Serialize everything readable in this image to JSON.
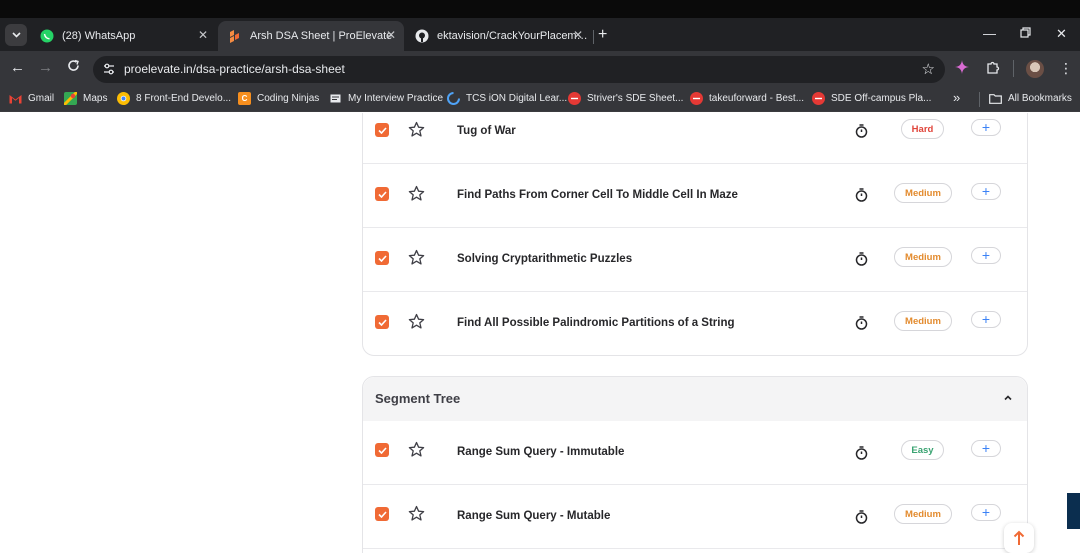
{
  "browser": {
    "tabs": [
      {
        "title": "(28) WhatsApp",
        "icon": "whatsapp-icon",
        "active": false
      },
      {
        "title": "Arsh DSA Sheet | ProElevate",
        "icon": "proelevate-icon",
        "active": true
      },
      {
        "title": "ektavision/CrackYourPlacement",
        "icon": "github-icon",
        "active": false
      }
    ],
    "url": {
      "host": "proelevate.in",
      "path": "/dsa-practice/arsh-dsa-sheet"
    },
    "bookmarks": [
      {
        "label": "Gmail",
        "icon": "gmail-icon"
      },
      {
        "label": "Maps",
        "icon": "maps-icon"
      },
      {
        "label": "8 Front-End Develo...",
        "icon": "chrome-icon"
      },
      {
        "label": "Coding Ninjas",
        "icon": "coding-ninjas-icon"
      },
      {
        "label": "My Interview Practice",
        "icon": "bookmark-icon"
      },
      {
        "label": "TCS iON Digital Lear...",
        "icon": "tcs-icon"
      },
      {
        "label": "Striver's SDE Sheet...",
        "icon": "tuf-icon"
      },
      {
        "label": "takeuforward - Best...",
        "icon": "tuf-icon"
      },
      {
        "label": "SDE Off-campus Pla...",
        "icon": "tuf-icon"
      }
    ],
    "bookmarks_overflow": "»",
    "all_bookmarks": "All Bookmarks",
    "colors": {
      "tab_bar": "#202124",
      "toolbar": "#35363a",
      "accent_checkbox": "#f06a35"
    }
  },
  "sheet": {
    "section_previous": {
      "questions": [
        {
          "name": "Tug of War",
          "difficulty": "Hard",
          "done": true
        },
        {
          "name": "Find Paths From Corner Cell To Middle Cell In Maze",
          "difficulty": "Medium",
          "done": true
        },
        {
          "name": "Solving Cryptarithmetic Puzzles",
          "difficulty": "Medium",
          "done": true
        },
        {
          "name": "Find All Possible Palindromic Partitions of a String",
          "difficulty": "Medium",
          "done": true
        }
      ]
    },
    "section_segment_tree": {
      "title": "Segment Tree",
      "questions": [
        {
          "name": "Range Sum Query - Immutable",
          "difficulty": "Easy",
          "done": true
        },
        {
          "name": "Range Sum Query - Mutable",
          "difficulty": "Medium",
          "done": true
        }
      ]
    },
    "add_label": "+"
  }
}
